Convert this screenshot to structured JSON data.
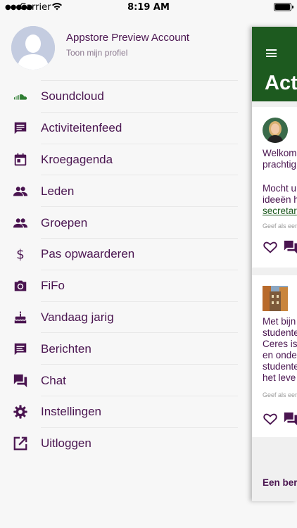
{
  "status_bar": {
    "carrier": "Carrier",
    "time": "8:19 AM"
  },
  "profile": {
    "name": "Appstore Preview Account",
    "link": "Toon mijn profiel"
  },
  "menu": [
    {
      "label": "Soundcloud",
      "icon": "soundcloud-icon"
    },
    {
      "label": "Activiteitenfeed",
      "icon": "message-square-icon"
    },
    {
      "label": "Kroegagenda",
      "icon": "calendar-icon"
    },
    {
      "label": "Leden",
      "icon": "people-icon"
    },
    {
      "label": "Groepen",
      "icon": "people-icon"
    },
    {
      "label": "Pas opwaarderen",
      "icon": "dollar-icon"
    },
    {
      "label": "FiFo",
      "icon": "camera-icon"
    },
    {
      "label": "Vandaag jarig",
      "icon": "cake-icon"
    },
    {
      "label": "Berichten",
      "icon": "chat-icon"
    },
    {
      "label": "Chat",
      "icon": "forum-icon"
    },
    {
      "label": "Instellingen",
      "icon": "gear-icon"
    },
    {
      "label": "Uitloggen",
      "icon": "external-link-icon"
    }
  ],
  "panel": {
    "title": "Act",
    "card1": {
      "line1": "Welkom",
      "line2": "prachtig",
      "line3": "Mocht u",
      "line4": "ideeën h",
      "link": "secretar",
      "small": "Geef als eer"
    },
    "card2": {
      "lines": "Met bijn\nstudente\nCeres is\nen onde\nstudente\nhet leve",
      "small": "Geef als eer"
    },
    "footer": "Een ber"
  },
  "colors": {
    "accent": "#4a1550",
    "header_green": "#1d5a1f",
    "soundcloud_green": "#2e7d32"
  }
}
